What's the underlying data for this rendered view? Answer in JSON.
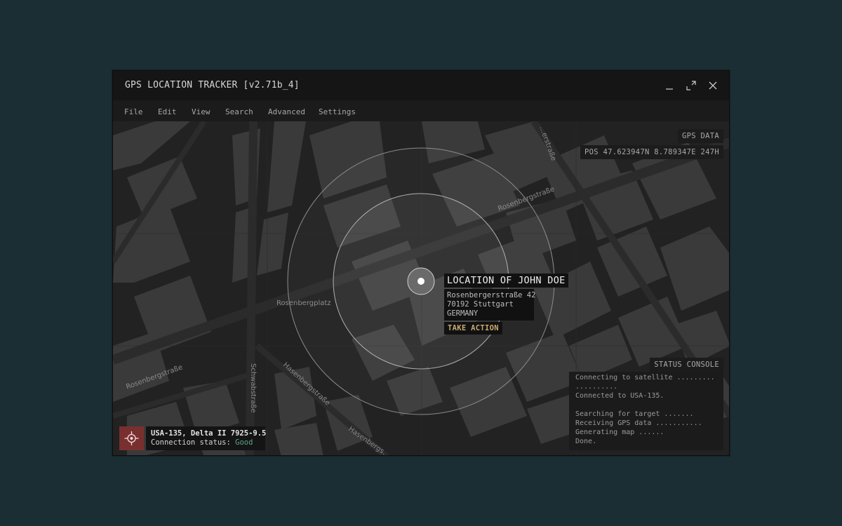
{
  "window": {
    "title": "GPS LOCATION TRACKER [v2.71b_4]"
  },
  "window_controls": [
    "minimize-icon",
    "maximize-icon",
    "close-icon"
  ],
  "menu": {
    "items": [
      "File",
      "Edit",
      "View",
      "Search",
      "Advanced",
      "Settings"
    ]
  },
  "map": {
    "street_labels": {
      "top_right": "…erstraße",
      "rosenberg_main": "Rosenbergstraße",
      "rosenbergplatz": "Rosenbergplatz",
      "rosenberg_lower_left": "Rosenbergstraße",
      "schwabstrasse": "Schwabstraße",
      "hasenbergstrasse": "Hasenbergstraße",
      "hasenberg_lower": "Hasenbergs…"
    }
  },
  "gps_panel": {
    "label": "GPS DATA",
    "position": "POS 47.623947N 8.789347E 247H"
  },
  "target": {
    "title": "LOCATION OF JOHN DOE",
    "address_line1": "Rosenbergerstraße 42",
    "address_line2": "70192 Stuttgart",
    "address_line3": "GERMANY",
    "action_label": "TAKE ACTION"
  },
  "status_console": {
    "label": "STATUS CONSOLE",
    "lines": [
      "Connecting to satellite .........",
      "..........",
      "Connected to USA-135.",
      "",
      "Searching for target .......",
      "Receiving GPS data ...........",
      "Generating map ......",
      "Done."
    ]
  },
  "satellite": {
    "icon": "crosshair-location-icon",
    "name": "USA-135, Delta II 7925-9.5",
    "status_prefix": "Connection status:",
    "status_value": "Good"
  },
  "colors": {
    "background": "#1a2e33",
    "window": "#151515",
    "map": "#222222",
    "accent_action": "#c9a970",
    "status_good": "#5aa58a",
    "icon_box": "#7a2f2f"
  }
}
